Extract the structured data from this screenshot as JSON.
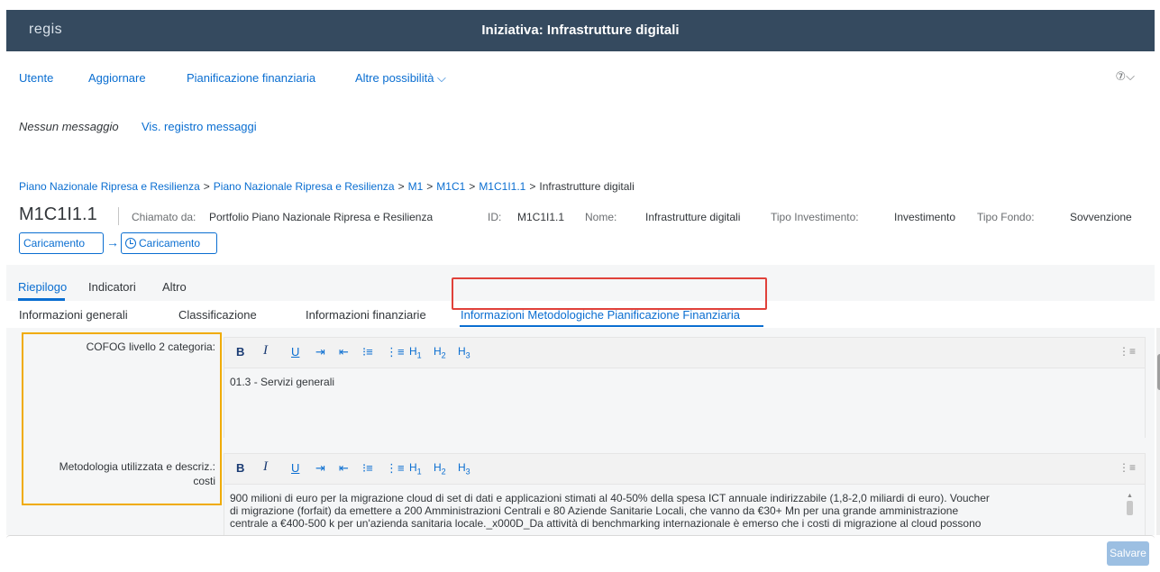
{
  "app": {
    "logo": "regis",
    "title": "Iniziativa: Infrastrutture digitali"
  },
  "menu": {
    "items": [
      "Utente",
      "Aggiornare",
      "Pianificazione finanziaria",
      "Altre possibilità ⌵"
    ],
    "help": "⑦⌵"
  },
  "messages": {
    "none": "Nessun messaggio",
    "view_log": "Vis. registro messaggi"
  },
  "breadcrumb": {
    "links": [
      "Piano Nazionale Ripresa e Resilienza",
      "Piano Nazionale Ripresa e Resilienza",
      "M1",
      "M1C1",
      "M1C1I1.1"
    ],
    "separator": ">",
    "current": "Infrastrutture digitali"
  },
  "object": {
    "title": "M1C1I1.1",
    "called_by_label": "Chiamato da:",
    "called_by_value": "Portfolio Piano Nazionale Ripresa e Resilienza",
    "id_label": "ID:",
    "id_value": "M1C1I1.1",
    "name_label": "Nome:",
    "name_value": "Infrastrutture digitali",
    "inv_type_label": "Tipo Investimento:",
    "inv_type_value": "Investimento",
    "fund_type_label": "Tipo Fondo:",
    "fund_type_value": "Sovvenzione"
  },
  "flow": {
    "step1": "Caricamento",
    "step2": "Caricamento"
  },
  "tabs_level1": [
    "Riepilogo",
    "Indicatori",
    "Altro"
  ],
  "tabs_level2": [
    "Informazioni generali",
    "Classificazione",
    "Informazioni finanziarie",
    "Informazioni Metodologiche Pianificazione Finanziaria"
  ],
  "fields": {
    "cofog_label": "COFOG livello 2 categoria:",
    "cofog_value": "01.3 - Servizi generali",
    "method_label_1": "Metodologia utilizzata e descriz.:",
    "method_label_2": "costi",
    "method_value_1": "900 milioni di euro per la migrazione cloud di set di dati e applicazioni stimati al 40-50% della spesa ICT annuale indirizzabile (1,8-2,0 miliardi di euro). Voucher",
    "method_value_2": "di migrazione (forfait) da emettere a 200 Amministrazioni Centrali e 80 Aziende Sanitarie Locali, che vanno da €30+ Mn per una grande amministrazione",
    "method_value_3": "centrale a €400-500 k per un'azienda sanitaria locale._x000D_Da attività di benchmarking internazionale è emerso che i costi di migrazione al cloud possono"
  },
  "toolbar": {
    "bold": "B",
    "italic": "I",
    "underline": "U",
    "indent": "⇥",
    "outdent": "⇤",
    "ol": "⁝≡",
    "ul": "⋮≡",
    "h1": "H",
    "h2": "H",
    "h3": "H",
    "h1n": "1",
    "h2n": "2",
    "h3n": "3",
    "more": "⋮≡"
  },
  "footer": {
    "save": "Salvare"
  },
  "colors": {
    "shell": "#354a5f",
    "accent": "#0a6ed1",
    "highlight_red": "#e0413a",
    "highlight_orange": "#f0ab00"
  }
}
